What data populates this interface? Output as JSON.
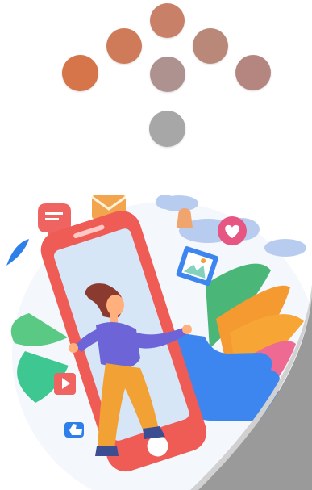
{
  "brand": {
    "logo_icon": "dotted-arrow-down-logo-icon",
    "colors": {
      "orange": "#cf7a58",
      "rose": "#b8837a",
      "taupe": "#aa928e",
      "grey": "#a7a7a7"
    }
  },
  "illustration": {
    "icon": "social-media-phone-illustration-icon",
    "accent_colors": {
      "phone": "#ef5b55",
      "screen": "#d6e6f6",
      "person_shirt": "#6d64d8",
      "person_pants": "#f2a235",
      "leaves_green": "#4fc38a",
      "leaves_pink": "#f26b8f",
      "thumb_blue": "#3e86ef",
      "message_red": "#ef6361",
      "envelope_orange": "#f3a54d",
      "cloud_blue": "#b8ccef"
    }
  }
}
